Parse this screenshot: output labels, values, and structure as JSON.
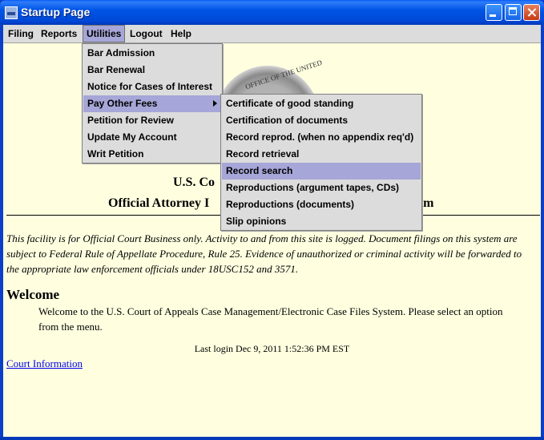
{
  "window": {
    "title": "Startup Page"
  },
  "menubar": {
    "items": [
      "Filing",
      "Reports",
      "Utilities",
      "Logout",
      "Help"
    ]
  },
  "utilities_menu": {
    "items": [
      "Bar Admission",
      "Bar Renewal",
      "Notice for Cases of Interest",
      "Pay Other Fees",
      "Petition for Review",
      "Update My Account",
      "Writ Petition"
    ]
  },
  "pay_other_fees_menu": {
    "items": [
      "Certificate of good standing",
      "Certification of documents",
      "Record reprod. (when no appendix req'd)",
      "Record retrieval",
      "Record search",
      "Reproductions (argument tapes, CDs)",
      "Reproductions (documents)",
      "Slip opinions"
    ]
  },
  "page": {
    "seal_text": "OFFICE OF THE UNITED",
    "heading_line1_left": "U.S. Co",
    "heading_line2_left": "Official Attorney I",
    "heading_line2_right": "em",
    "notice": "This facility is for Official Court Business only. Activity to and from this site is logged. Document filings on this system are subject to Federal Rule of Appellate Procedure, Rule 25. Evidence of unauthorized or criminal activity will be forwarded to the appropriate law enforcement officials under 18USC152 and 3571.",
    "welcome_heading": "Welcome",
    "welcome_text": "Welcome to the U.S. Court of Appeals Case Management/Electronic Case Files System. Please select an option from the menu.",
    "last_login": "Last login Dec 9, 2011 1:52:36 PM EST",
    "court_info_link": "Court Information"
  }
}
